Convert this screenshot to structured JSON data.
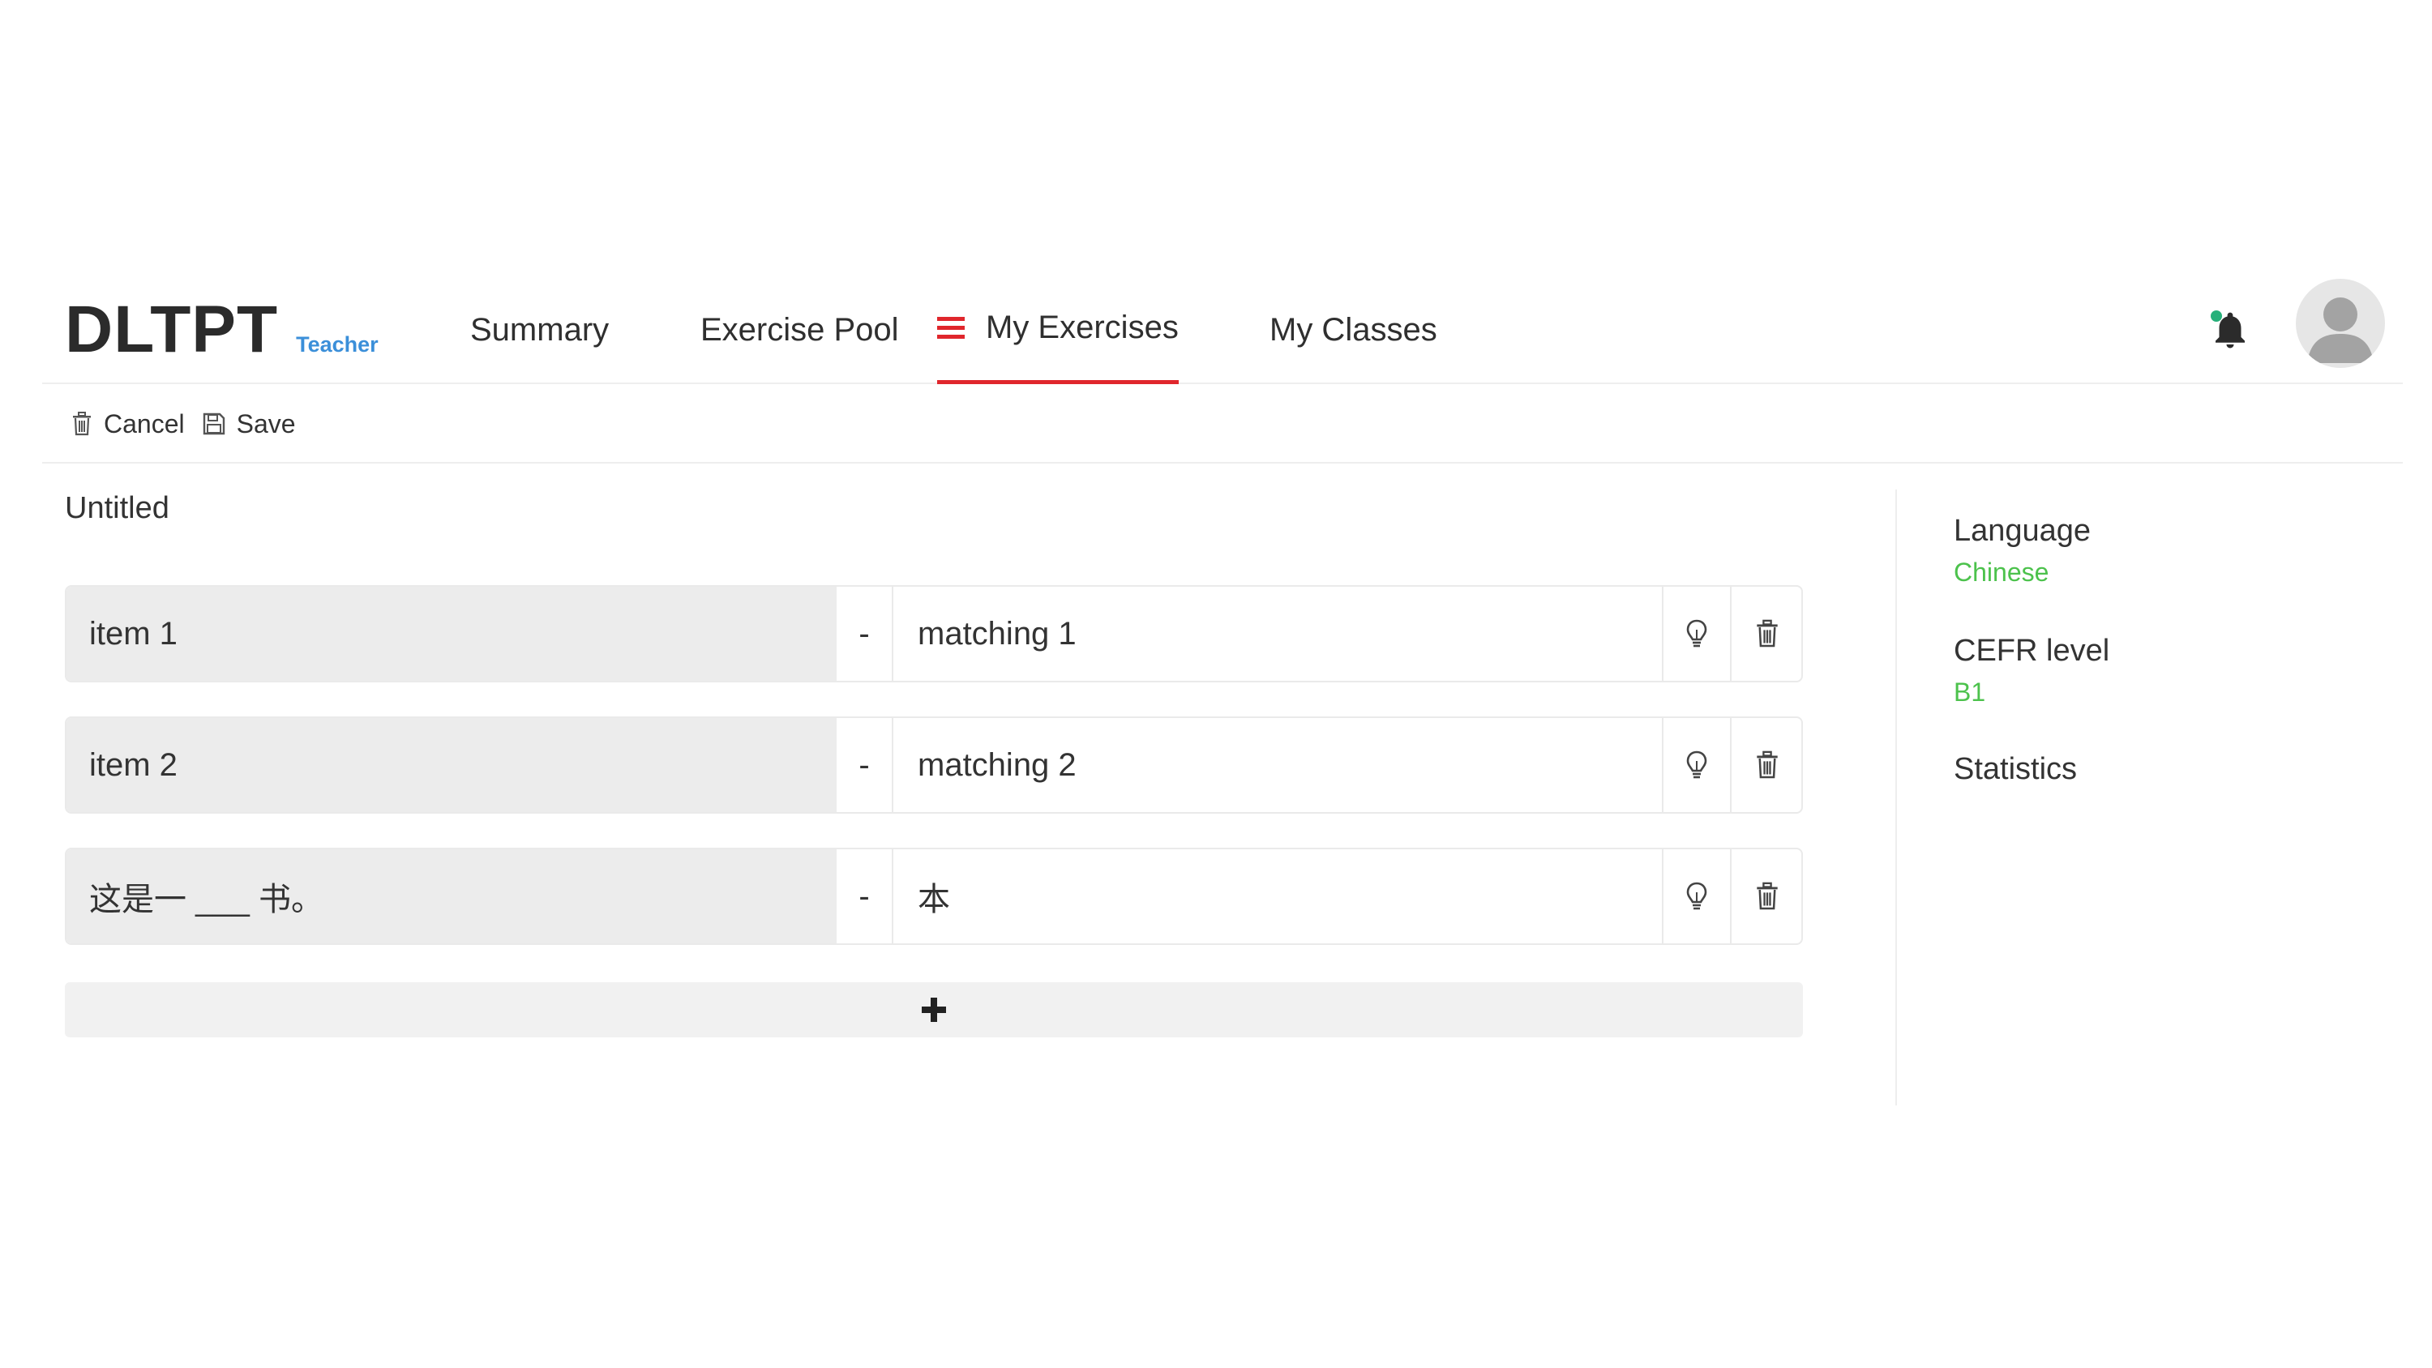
{
  "header": {
    "brand": "DLTPT",
    "role": "Teacher",
    "nav": [
      {
        "label": "Summary"
      },
      {
        "label": "Exercise Pool"
      },
      {
        "label": "My Exercises",
        "active": true
      },
      {
        "label": "My Classes"
      }
    ],
    "icons": {
      "notifications": "bell-icon",
      "avatar": "user-avatar-icon",
      "menu": "hamburger-icon"
    },
    "accent_color": "#e0262c",
    "role_color": "#3b8fd9"
  },
  "toolbar": {
    "cancel_label": "Cancel",
    "save_label": "Save"
  },
  "exercise": {
    "title": "Untitled",
    "rows": [
      {
        "item": "item 1",
        "separator": "-",
        "match": "matching 1"
      },
      {
        "item": "item 2",
        "separator": "-",
        "match": "matching 2"
      },
      {
        "item": "这是一 ___ 书。",
        "separator": "-",
        "match": "本"
      }
    ],
    "add_label": "+"
  },
  "sidebar": {
    "language_label": "Language",
    "language_value": "Chinese",
    "cefr_label": "CEFR level",
    "cefr_value": "B1",
    "statistics_label": "Statistics",
    "value_color": "#4cc24c"
  }
}
